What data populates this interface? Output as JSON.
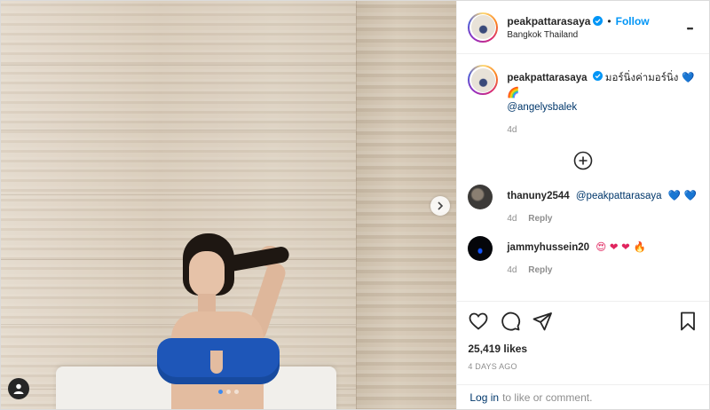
{
  "post": {
    "author": "peakpattarasaya",
    "location": "Bangkok Thailand",
    "follow_label": "Follow",
    "separator": "•",
    "more_label": "•••",
    "caption_text": "มอร์นิ่งค่ามอร์นิ่ง 💙 🌈",
    "caption_mention": "@angelysbalek",
    "caption_time": "4d",
    "likes": "25,419 likes",
    "date": "4 DAYS AGO"
  },
  "comments": [
    {
      "user": "thanuny2544",
      "mention": "@peakpattarasaya",
      "emojis": "💙 💙",
      "time": "4d",
      "reply_label": "Reply"
    },
    {
      "user": "jammyhussein20",
      "emojis": "😍 ❤ ❤ 🔥",
      "time": "4d",
      "reply_label": "Reply"
    }
  ],
  "login": {
    "link": "Log in",
    "text": "to like or comment."
  },
  "colors": {
    "accent": "#0095f6",
    "link": "#00376b",
    "muted": "#8e8e8e",
    "active_dot": "#3b8af2"
  }
}
